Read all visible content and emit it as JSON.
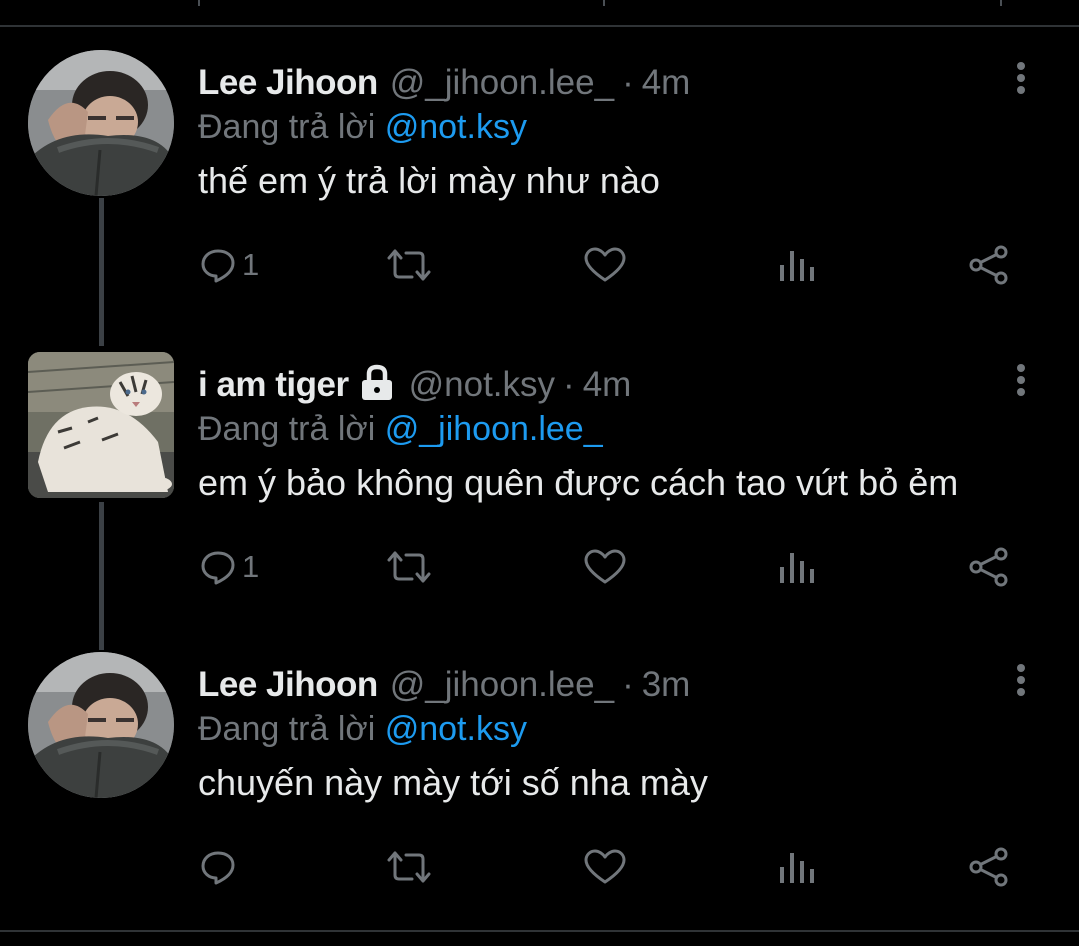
{
  "colors": {
    "background": "#000000",
    "text_primary": "#e7e9ea",
    "text_secondary": "#71767b",
    "mention": "#1d9bf0",
    "divider": "#2f3336",
    "thread_line": "#3b4045"
  },
  "tweets": [
    {
      "display_name": "Lee Jihoon",
      "handle": "@_jihoon.lee_",
      "separator": "·",
      "time": "4m",
      "reply_prefix": "Đang trả lời",
      "reply_to": "@not.ksy",
      "text": "thế em ý trả lời mày như nào",
      "reply_count": "1",
      "protected": false,
      "avatar_icon": "avatar-jihoon-icon"
    },
    {
      "display_name": "i am tiger",
      "handle": "@not.ksy",
      "separator": "·",
      "time": "4m",
      "reply_prefix": "Đang trả lời",
      "reply_to": "@_jihoon.lee_",
      "text": "em ý bảo không quên được cách tao vứt bỏ ẻm",
      "reply_count": "1",
      "protected": true,
      "avatar_icon": "avatar-tiger-icon"
    },
    {
      "display_name": "Lee Jihoon",
      "handle": "@_jihoon.lee_",
      "separator": "·",
      "time": "3m",
      "reply_prefix": "Đang trả lời",
      "reply_to": "@not.ksy",
      "text": "chuyến này mày tới số nha mày",
      "reply_count": "",
      "protected": false,
      "avatar_icon": "avatar-jihoon-icon"
    }
  ],
  "action_icons": [
    "reply-icon",
    "retweet-icon",
    "like-icon",
    "views-icon",
    "share-icon"
  ],
  "more_icon": "more-vertical-icon",
  "lock_icon": "lock-icon"
}
